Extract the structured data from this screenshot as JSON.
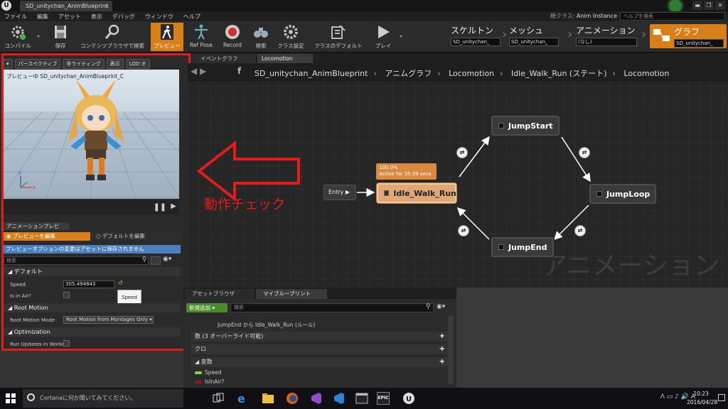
{
  "titlebar": {
    "logo": "U",
    "doc_tab": "SD_unitychan_AnimBlueprint",
    "doc_tab_close": "×",
    "window_buttons": [
      "▬",
      "❐",
      "✕"
    ]
  },
  "menu": [
    "ファイル",
    "編集",
    "アセット",
    "表示",
    "デバッグ",
    "ウィンドウ",
    "ヘルプ"
  ],
  "parent_class": {
    "label": "親クラス",
    "value": "Anim Instance"
  },
  "help_search": {
    "placeholder": "ヘルプを検索"
  },
  "toolbar": {
    "compile": "コンパイル",
    "save": "保存",
    "find_in_cb": "コンテンツブラウザで検索",
    "preview": "プレビュー",
    "ref_pose": "Ref Pose",
    "record": "Record",
    "search": "検索",
    "class_settings": "クラス設定",
    "class_defaults": "クラスのデフォルト",
    "play": "プレイ"
  },
  "modes": {
    "skeleton": {
      "title": "スケルトン",
      "value": "SD_unitychan_"
    },
    "mesh": {
      "title": "メッシュ",
      "value": "SD_unitychan_"
    },
    "animation": {
      "title": "アニメーション",
      "value": "(なし)"
    },
    "graph": {
      "title": "グラフ",
      "value": "SD_unitychan_"
    }
  },
  "viewport": {
    "buttons": [
      "▾",
      "パースペクティブ",
      "非ライティング",
      "表示",
      "LOD オ"
    ],
    "preview_label": "プレビュー中 SD_unitychan_AnimBlueprint_C",
    "play_pause": "❚❚",
    "step": "▶"
  },
  "anim_preview": {
    "tab": "アニメーションプレビ",
    "edit_preview": "プレビューを編集",
    "edit_defaults": "デフォルトを編集",
    "info": "プレビューオプションの変更はアセットに保存されません",
    "search_placeholder": "検索",
    "search_icon": "⚲",
    "eye_icon": "◉▾"
  },
  "details": {
    "cat_default": "デフォルト",
    "speed_label": "Speed",
    "speed_value": "305.494843",
    "speed_reset": "↺",
    "tooltip": "Speed",
    "inair_label": "Is in Air?",
    "inair_checked": false,
    "cat_root_motion": "Root Motion",
    "rm_mode_label": "Root Motion Mode",
    "rm_mode_value": "Root Motion from Montages Only ▾",
    "cat_optimization": "Optimization",
    "run_label": "Run Updates in Worke",
    "run_checked": false
  },
  "graph_tabs": {
    "event": "イベントグラフ",
    "locomotion": "Locomotion"
  },
  "breadcrumb": {
    "nav": "◀ ▶",
    "fn": "f",
    "items": [
      "SD_unitychan_AnimBlueprint",
      "アニムグラフ",
      "Locomotion",
      "Idle_Walk_Run (ステート)",
      "Locomotion"
    ]
  },
  "graph": {
    "watermark": "アニメーション",
    "entry": "Entry ▶",
    "active_tip": [
      "100.0%",
      "Active for 35.39 secs"
    ],
    "nodes": {
      "idle": "Idle_Walk_Run",
      "jump_start": "JumpStart",
      "jump_loop": "JumpLoop",
      "jump_end": "JumpEnd"
    },
    "transition_glyph": "⇄"
  },
  "annotation": "動作チェック",
  "bottom_tabs": {
    "assets": "アセットブラウザ",
    "my_blueprint": "マイブループリント"
  },
  "my_blueprint": {
    "add_new": "新規追加 ▾",
    "search_placeholder": "検索",
    "search_icon": "⚲",
    "eye_icon": "◉▾",
    "truncated_row": "JumpEnd から Idle_Walk_Run (ルール)",
    "cat_functions": "数 (3 オーバーライド可能)",
    "cat_macros": "クロ",
    "cat_variables": "変数",
    "plus": "+",
    "variables": [
      {
        "name": "Speed",
        "color": "#8fd22a"
      },
      {
        "name": "IsInAir?",
        "color": "#8a1c1c"
      }
    ]
  },
  "taskbar": {
    "cortana": "Cortanaに何か聞いてみてください。",
    "tray": "ᐱ ▭ ♪ 🔊 A",
    "time": "10:23",
    "date": "2016/04/28",
    "epic_label": "EPIC"
  }
}
